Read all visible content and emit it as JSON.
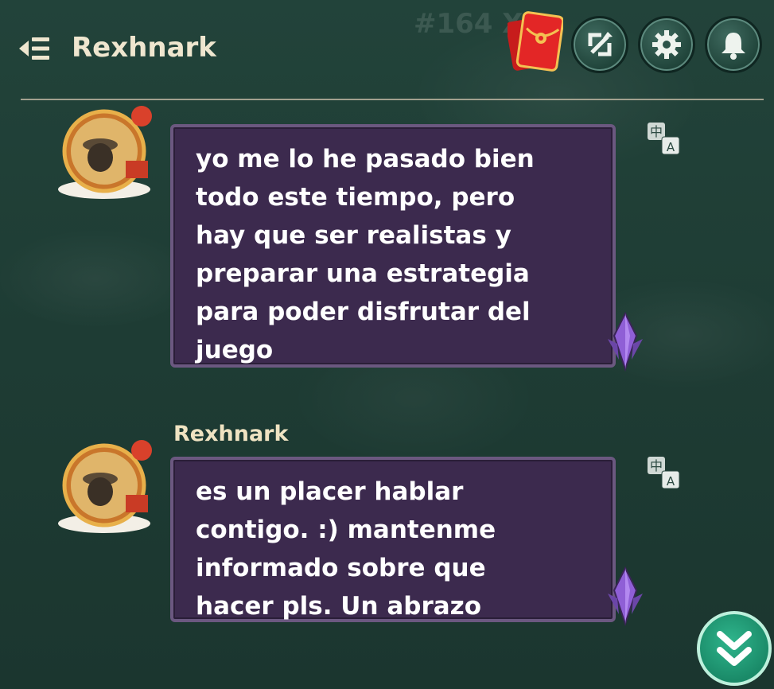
{
  "header": {
    "title": "Rexhnark",
    "background_text": "#164 X:"
  },
  "messages": [
    {
      "text": "yo me lo he pasado bien\ntodo este tiempo, pero\nhay que ser realistas y\npreparar una estrategia\npara poder disfrutar del\njuego"
    },
    {
      "sender": "Rexhnark",
      "text": "es un placer hablar\ncontigo. :) mantenme\ninformado sobre que\nhacer pls. Un abrazo"
    }
  ],
  "icons": {
    "back": "back-menu-icon",
    "envelope": "red-envelope-icon",
    "sync": "sync-icon",
    "settings": "gear-icon",
    "notifications": "bell-icon",
    "translate": "translate-icon",
    "scroll_down": "double-chevron-down-icon"
  },
  "colors": {
    "bubble_bg": "#3c2a4e",
    "bubble_border": "#6b5880",
    "accent_green": "#2fb58c",
    "title_text": "#efe6cf"
  }
}
